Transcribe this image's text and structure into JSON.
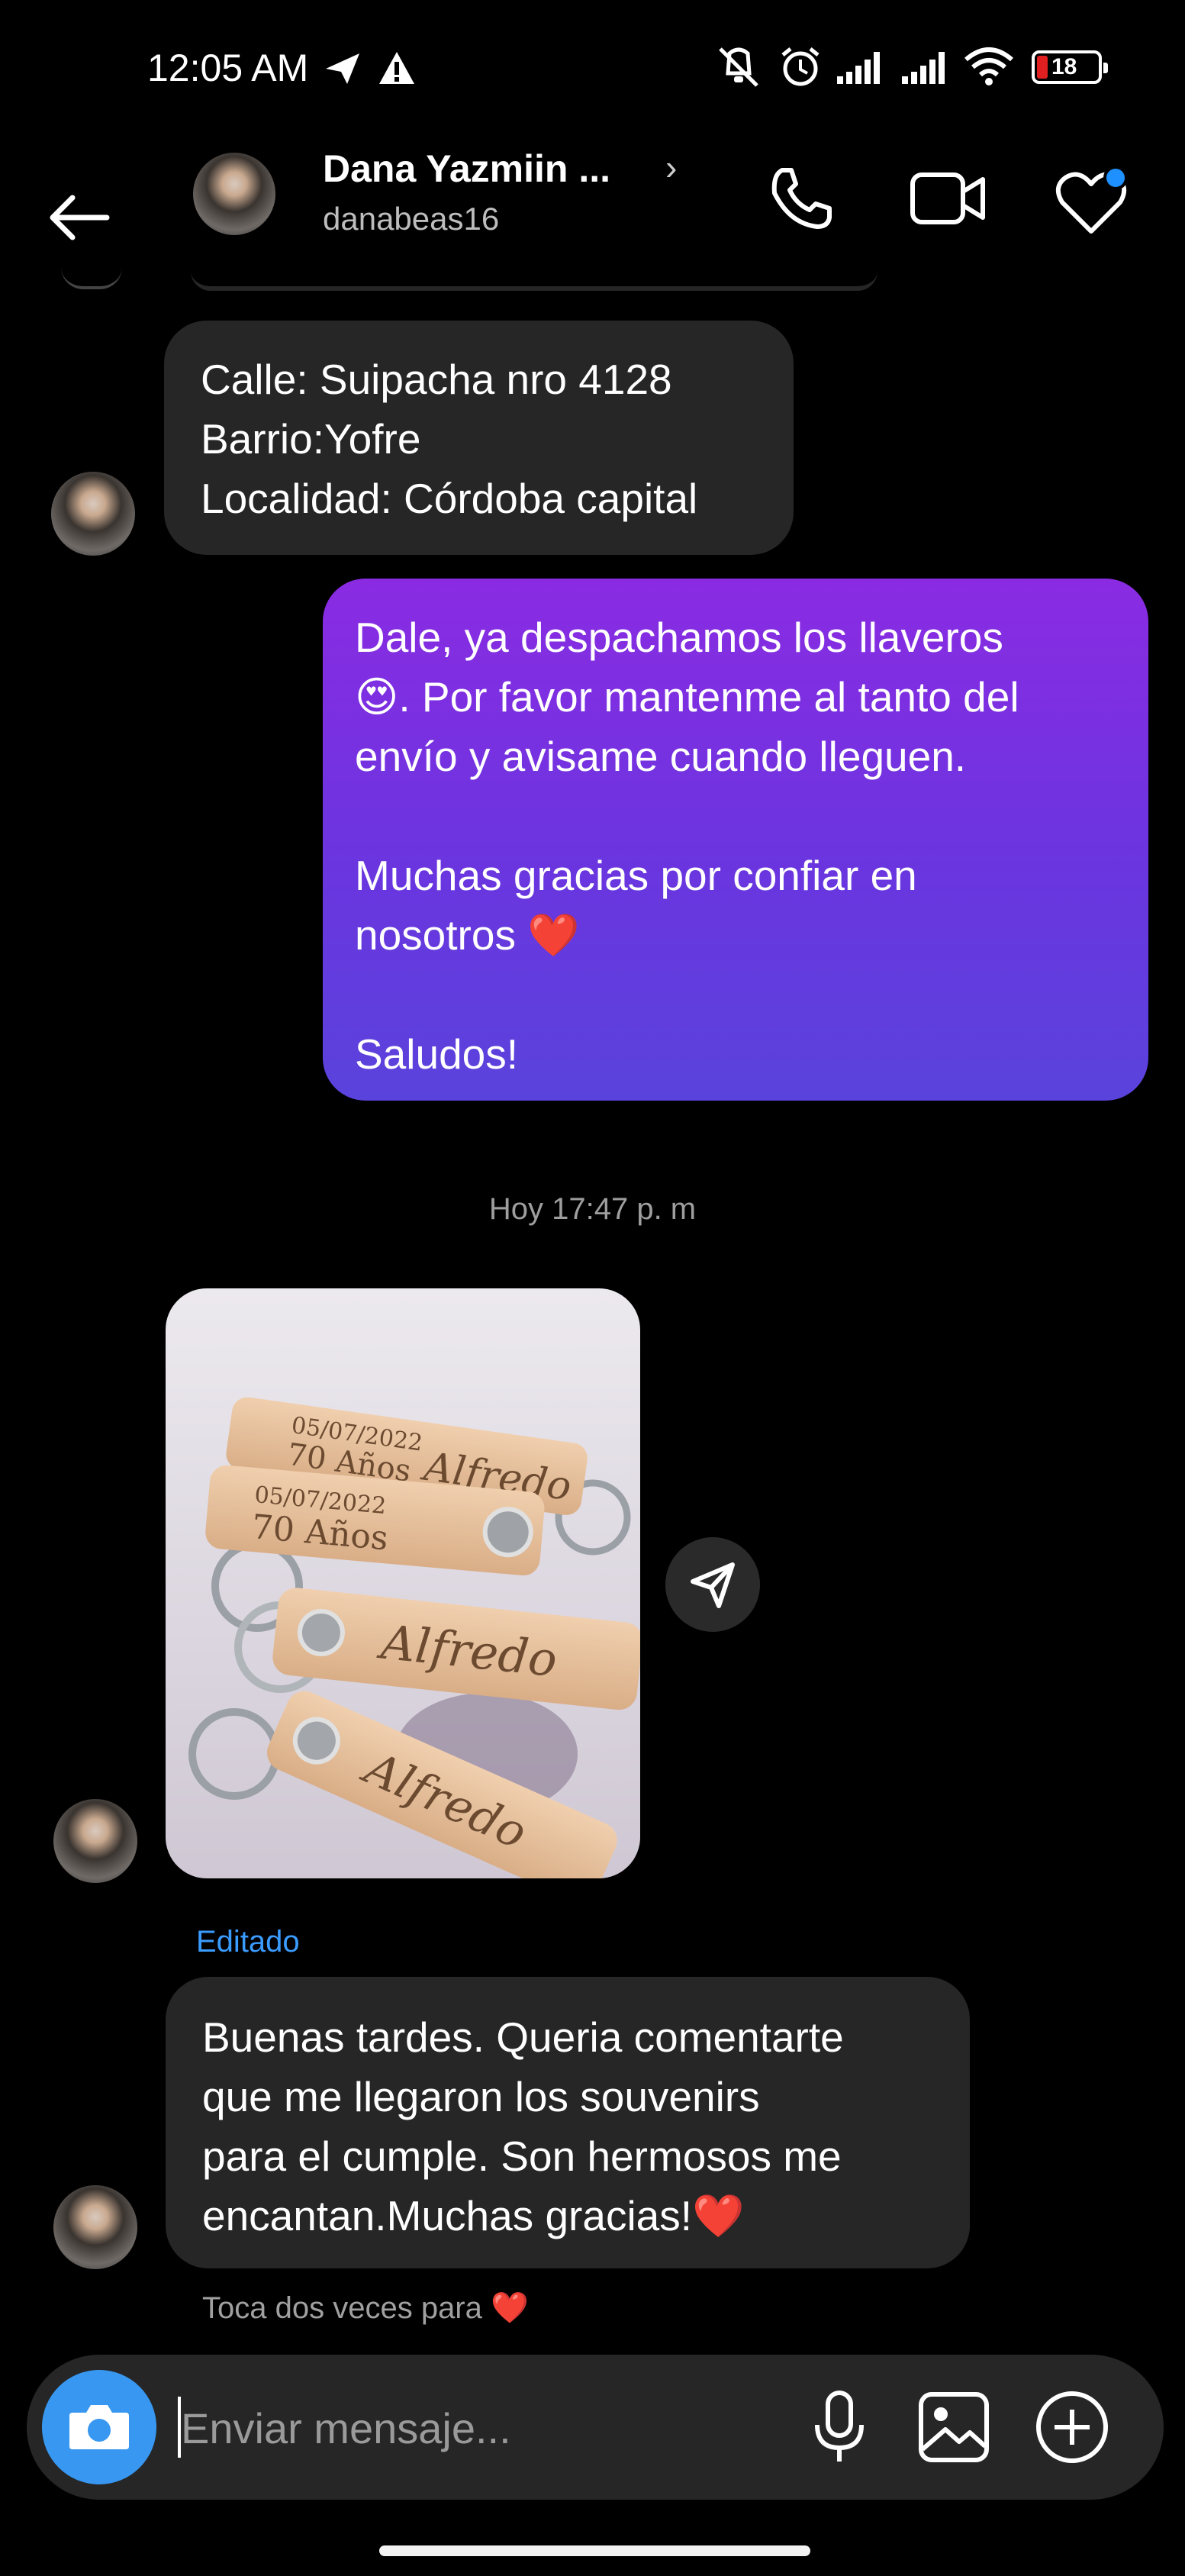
{
  "status_bar": {
    "time": "12:05 AM",
    "battery": "18",
    "icons": [
      "send-icon",
      "warning-icon",
      "vibrate-off-icon",
      "alarm-icon",
      "signal-icon",
      "signal-icon",
      "wifi-icon",
      "battery-icon"
    ]
  },
  "header": {
    "contact_name": "Dana Yazmiin ...",
    "chevron": "›",
    "handle": "danabeas16"
  },
  "messages": {
    "address": {
      "lines": [
        "Calle: Suipacha nro 4128",
        "Barrio:Yofre",
        "Localidad: Córdoba capital"
      ]
    },
    "shipped": {
      "lines": [
        "Dale, ya despachamos los llaveros",
        "😍. Por favor mantenme al tanto del",
        "envío y avisame cuando lleguen.",
        "",
        "Muchas gracias por confiar en",
        "nosotros ❤️",
        "",
        "Saludos!"
      ]
    },
    "timestamp": "Hoy 17:47 p. m",
    "photo": {
      "keychain_texts": [
        "05/07/2022",
        "70 Años",
        "Alfredo"
      ]
    },
    "edited_label": "Editado",
    "thanks": {
      "lines": [
        "Buenas tardes. Queria comentarte",
        "que me llegaron los souvenirs",
        "para el cumple. Son hermosos me",
        "encantan.Muchas gracias!❤️"
      ]
    },
    "double_tap_hint": "Toca dos veces para ❤️"
  },
  "composer": {
    "placeholder": "Enviar mensaje..."
  },
  "colors": {
    "background": "#000000",
    "incoming_bubble": "#262626",
    "outgoing_gradient_top": "#8a2be2",
    "outgoing_gradient_bottom": "#5a43dc",
    "accent_blue": "#3897f0",
    "edited_blue": "#3b9cff"
  }
}
